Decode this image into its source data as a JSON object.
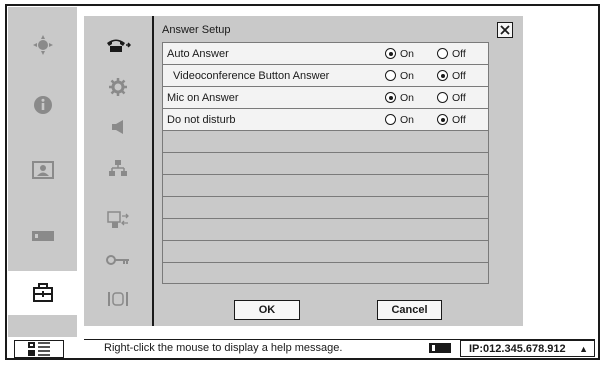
{
  "dialog": {
    "title": "Answer Setup",
    "rows": [
      {
        "label": "Auto Answer",
        "indent": false,
        "on_label": "On",
        "off_label": "Off",
        "selected": "on"
      },
      {
        "label": "Videoconference Button Answer",
        "indent": true,
        "on_label": "On",
        "off_label": "Off",
        "selected": "off"
      },
      {
        "label": "Mic on Answer",
        "indent": false,
        "on_label": "On",
        "off_label": "Off",
        "selected": "on"
      },
      {
        "label": "Do not disturb",
        "indent": false,
        "on_label": "On",
        "off_label": "Off",
        "selected": "off"
      }
    ],
    "ok_label": "OK",
    "cancel_label": "Cancel"
  },
  "status": {
    "help_text": "Right-click the mouse to display a help message.",
    "ip": "IP:012.345.678.912"
  },
  "icons": {
    "left_nav": [
      "camera-control-icon",
      "info-icon",
      "contact-icon",
      "video-input-icon",
      "setup-toolbox-icon"
    ],
    "categories": [
      "telephone-answer-icon",
      "gear-icon",
      "speaker-icon",
      "network-icon",
      "display-icon",
      "key-icon",
      "frame-icon"
    ]
  },
  "colors": {
    "panel": "#c9c9c9",
    "row_fill": "#f3f3f3",
    "outline": "#1a1a1a"
  }
}
